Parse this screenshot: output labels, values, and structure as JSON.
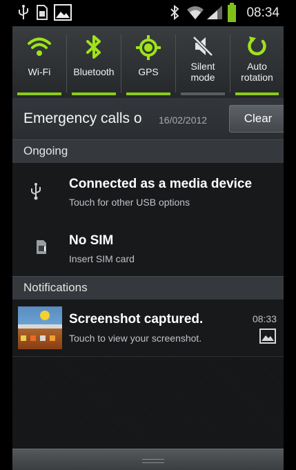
{
  "status_bar": {
    "time": "08:34",
    "icons": [
      "usb-icon",
      "sim-card-icon",
      "picture-icon",
      "bluetooth-icon",
      "wifi-icon",
      "signal-icon",
      "battery-icon"
    ]
  },
  "quick_settings": {
    "tiles": [
      {
        "label": "Wi-Fi",
        "icon": "wifi-icon",
        "enabled": true
      },
      {
        "label": "Bluetooth",
        "icon": "bluetooth-icon",
        "enabled": true
      },
      {
        "label": "GPS",
        "icon": "gps-icon",
        "enabled": true
      },
      {
        "label": "Silent mode",
        "icon": "silent-mode-icon",
        "enabled": false
      },
      {
        "label": "Auto rotation",
        "icon": "rotation-icon",
        "enabled": true
      }
    ],
    "accent_color": "#8ccc16"
  },
  "emergency": {
    "carrier_text": "Emergency calls o",
    "date": "16/02/2012",
    "clear_label": "Clear"
  },
  "sections": {
    "ongoing_title": "Ongoing",
    "notifications_title": "Notifications"
  },
  "ongoing": [
    {
      "title": "Connected as a media device",
      "subtitle": "Touch for other USB options",
      "icon": "usb-icon"
    },
    {
      "title": "No SIM",
      "subtitle": "Insert SIM card",
      "icon": "sim-card-icon"
    }
  ],
  "notifications": [
    {
      "title": "Screenshot captured.",
      "subtitle": "Touch to view your screenshot.",
      "time": "08:33",
      "icon": "picture-icon"
    }
  ]
}
